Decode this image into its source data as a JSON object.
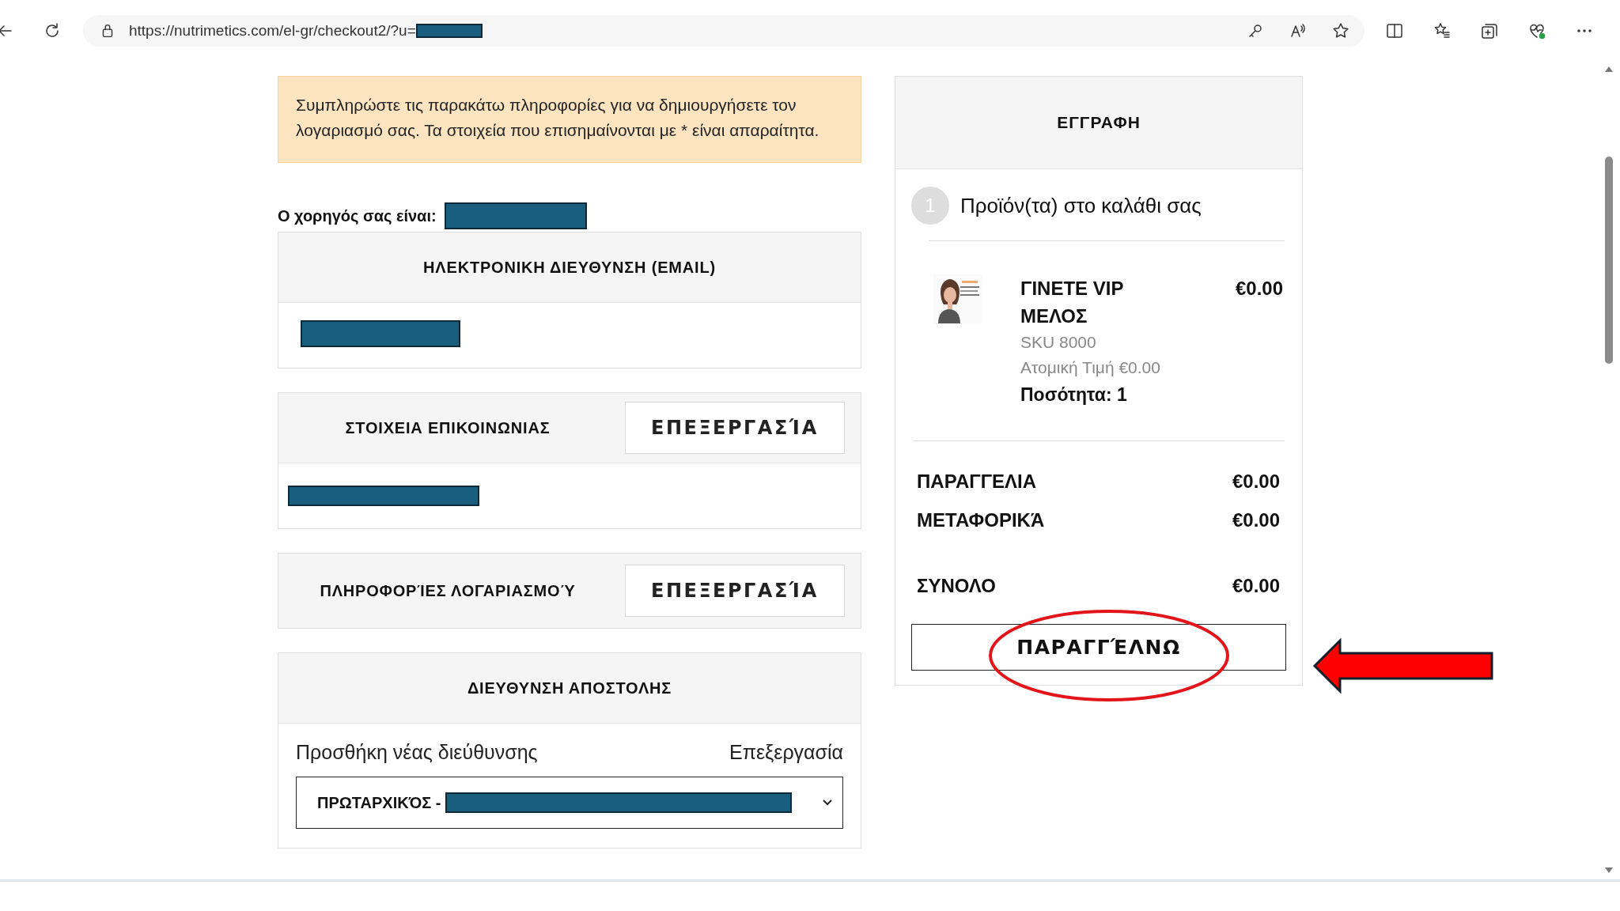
{
  "browser": {
    "url": "https://nutrimetics.com/el-gr/checkout2/?u="
  },
  "notice": "Συμπληρώστε τις παρακάτω πληροφορίες για να δημιουργήσετε τον λογαριασμό σας. Τα στοιχεία που επισημαίνονται με * είναι απαραίτητα.",
  "sponsor_label": "Ο χορηγός σας είναι:",
  "sections": [
    {
      "kind": "email",
      "title": "ΗΛΕΚΤΡΟΝΙΚΗ ΔΙΕΥΘΥΝΣΗ (EMAIL)"
    },
    {
      "kind": "contact",
      "title": "ΣΤΟΙΧΕΙΑ ΕΠΙΚΟΙΝΩΝΙΑΣ",
      "button": "ΕΠΕΞΕΡΓΑΣΊΑ"
    },
    {
      "kind": "account",
      "title": "ΠΛΗΡΟΦΟΡΊΕΣ ΛΟΓΑΡΙΑΣΜΟΎ",
      "button": "ΕΠΕΞΕΡΓΑΣΊΑ"
    },
    {
      "kind": "shipping",
      "title": "ΔΙΕΥΘΥΝΣΗ ΑΠΟΣΤΟΛΗΣ",
      "add_link": "Προσθήκη νέας διεύθυνσης",
      "edit_link": "Επεξεργασία",
      "select_value": "ΠΡΩΤΑΡΧΙΚΌΣ -"
    }
  ],
  "cart": {
    "title": "ΕΓΓΡΑΦΗ",
    "step": "1",
    "step_label": "Προϊόν(τα) στο καλάθι σας",
    "items": [
      {
        "name": "ΓΙΝΕΤΕ VIP ΜΕΛΟΣ",
        "price": "€0.00",
        "sku": "SKU 8000",
        "unit_price": "Ατομική Τιμή €0.00",
        "quantity": "Ποσότητα: 1"
      }
    ],
    "totals": [
      {
        "kind": "line",
        "label": "ΠΑΡΑΓΓΕΛΙΑ",
        "value": "€0.00"
      },
      {
        "kind": "line",
        "label": "ΜΕΤΑΦΟΡΙΚΆ",
        "value": "€0.00"
      },
      {
        "kind": "grand",
        "label": "ΣΥΝΟΛΟ",
        "value": "€0.00"
      }
    ],
    "submit": "ΠΑΡΑΓΓΈΛΝΩ"
  }
}
